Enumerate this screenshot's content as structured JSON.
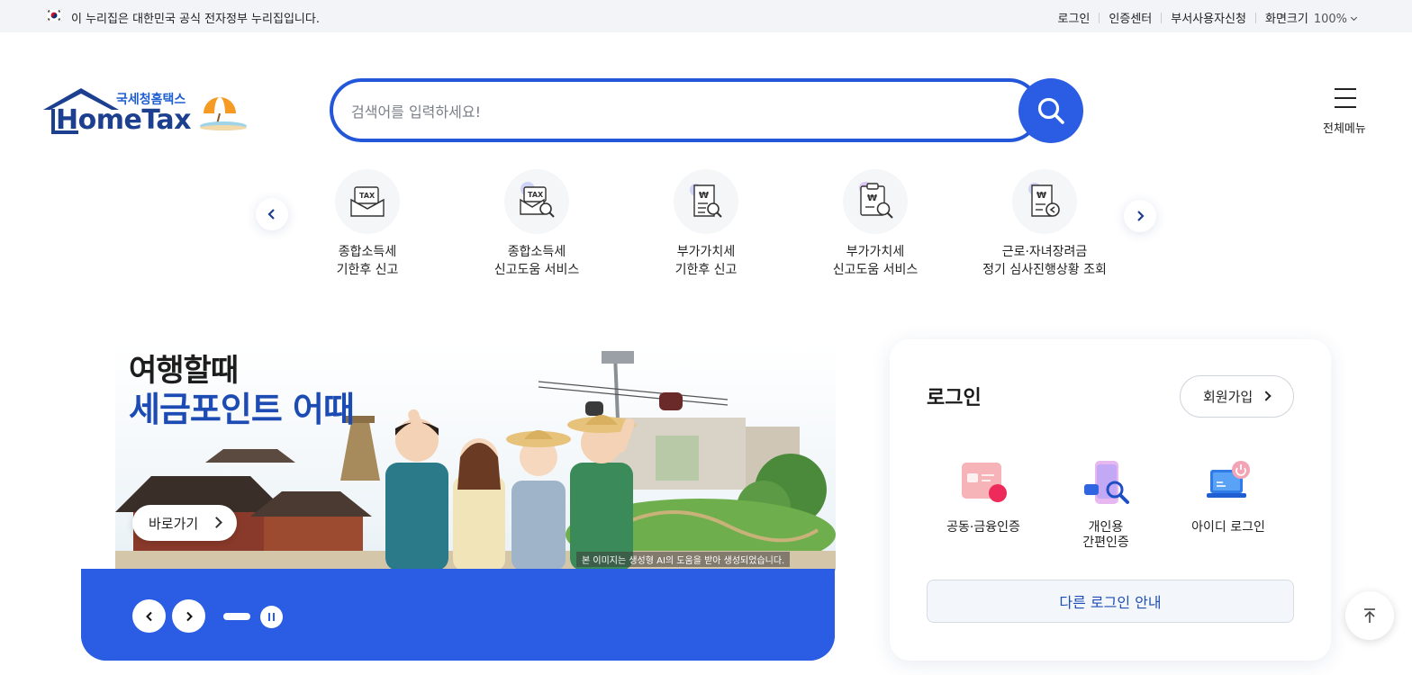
{
  "topbar": {
    "gov_notice": "이 누리집은 대한민국 공식 전자정부 누리집입니다.",
    "links": [
      "로그인",
      "인증센터",
      "부서사용자신청"
    ],
    "zoom_label": "화면크기",
    "zoom_value": "100%"
  },
  "header": {
    "logo_sub": "국세청홈택스",
    "logo_main": "HomeTax",
    "search_placeholder": "검색어를 입력하세요!",
    "menu_label": "전체메뉴"
  },
  "quick_services": [
    {
      "line1": "종합소득세",
      "line2": "기한후 신고",
      "icon": "tax-envelope-icon"
    },
    {
      "line1": "종합소득세",
      "line2": "신고도움 서비스",
      "icon": "tax-search-icon"
    },
    {
      "line1": "부가가치세",
      "line2": "기한후 신고",
      "icon": "won-document-icon"
    },
    {
      "line1": "부가가치세",
      "line2": "신고도움 서비스",
      "icon": "won-clipboard-search-icon"
    },
    {
      "line1": "근로·자녀장려금",
      "line2": "정기 심사진행상황 조회",
      "icon": "won-document-clock-icon"
    }
  ],
  "banner": {
    "title_line1": "여행할때",
    "title_line2": "세금포인트 어때",
    "goto_label": "바로가기",
    "ai_notice": "본 이미지는 생성형 AI의 도움을 받아 생성되었습니다."
  },
  "login": {
    "title": "로그인",
    "join_label": "회원가입",
    "options": [
      {
        "label": "공동·금융인증",
        "icon": "certificate-card-icon"
      },
      {
        "label": "개인용\n간편인증",
        "icon": "phone-search-icon"
      },
      {
        "label": "아이디 로그인",
        "icon": "laptop-power-icon"
      }
    ],
    "other_label": "다른 로그인 안내"
  },
  "colors": {
    "primary": "#2a5de3",
    "brand_navy": "#1d3f8f",
    "topbar_bg": "#f3f4f7"
  }
}
